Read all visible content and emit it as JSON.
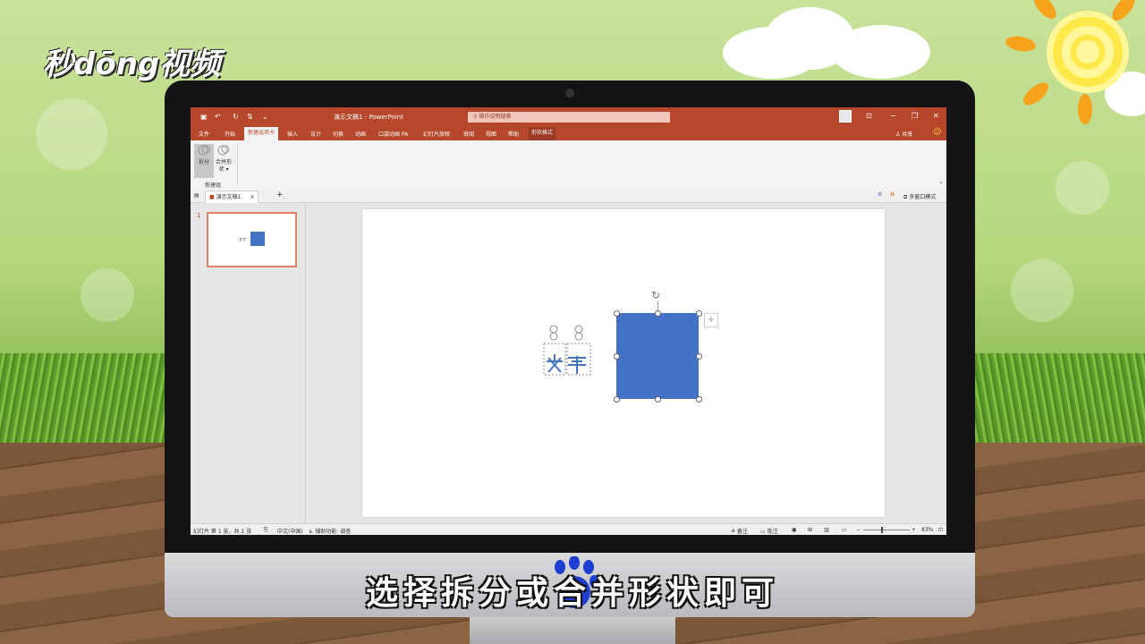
{
  "watermark": {
    "logo_text": "秒dōng视频"
  },
  "app": {
    "quick_access": [
      "save-icon",
      "undo-icon",
      "redo-icon",
      "customize-icon"
    ],
    "title": "演示文稿1 - PowerPoint",
    "search_placeholder": "操作说明搜索",
    "window_controls": {
      "minimize": "−",
      "restore": "❐",
      "close": "✕"
    },
    "share_label": "共享"
  },
  "ribbon_tabs": [
    {
      "label": "文件"
    },
    {
      "label": "开始"
    },
    {
      "label": "新建选项卡"
    },
    {
      "label": "插入"
    },
    {
      "label": "设计"
    },
    {
      "label": "切换"
    },
    {
      "label": "动画"
    },
    {
      "label": "口袋动画 PA"
    },
    {
      "label": "幻灯片放映"
    },
    {
      "label": "审阅"
    },
    {
      "label": "视图"
    },
    {
      "label": "帮助"
    },
    {
      "label": "形状格式"
    }
  ],
  "ribbon": {
    "split_label": "拆分",
    "merge_label": "合并形状",
    "group_label": "新建组"
  },
  "doc_tabs": {
    "active": "演示文稿1",
    "close": "×",
    "add": "+",
    "multi_window": "多窗口模式"
  },
  "slides": {
    "number": "1",
    "thumb_text": "文字"
  },
  "status": {
    "slide_info": "幻灯片 第 1 张，共 1 张",
    "language": "中文(中国)",
    "accessibility": "辅助功能: 调查",
    "notes": "备注",
    "comments": "批注",
    "zoom": "83%"
  },
  "caption": "选择拆分或合并形状即可",
  "colors": {
    "accent": "#b7472a",
    "shape_fill": "#4472c4"
  }
}
